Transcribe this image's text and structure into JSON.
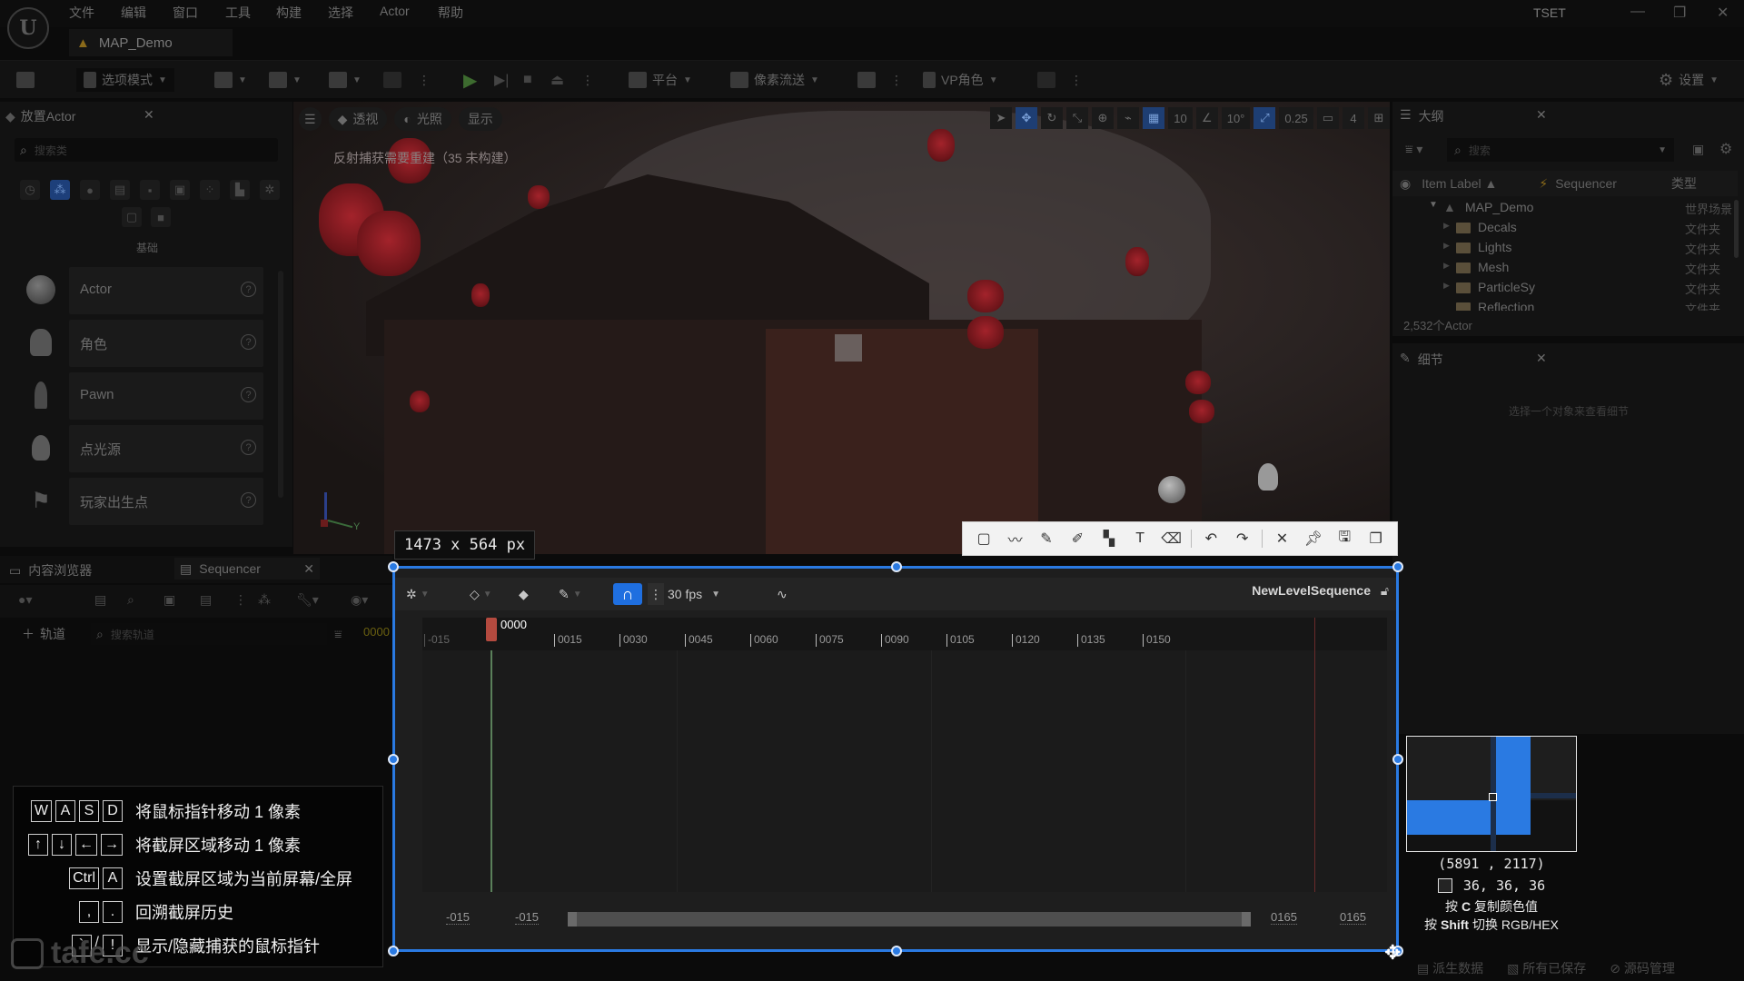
{
  "menubar": {
    "items": [
      "文件",
      "编辑",
      "窗口",
      "工具",
      "构建",
      "选择",
      "Actor",
      "帮助"
    ],
    "title": "TSET",
    "window_controls": [
      "minimize",
      "restore",
      "close"
    ]
  },
  "doc_tab": {
    "label": "MAP_Demo"
  },
  "toolbar": {
    "mode_label": "选项模式",
    "platform_label": "平台",
    "pixel_streaming_label": "像素流送",
    "vp_role_label": "VP角色",
    "settings_label": "设置"
  },
  "place_actors": {
    "title": "放置Actor",
    "search_placeholder": "搜索类",
    "section_label": "基础",
    "items": [
      {
        "label": "Actor",
        "icon": "sphere-icon"
      },
      {
        "label": "角色",
        "icon": "character-icon"
      },
      {
        "label": "Pawn",
        "icon": "pawn-icon"
      },
      {
        "label": "点光源",
        "icon": "point-light-icon"
      },
      {
        "label": "玩家出生点",
        "icon": "player-start-icon"
      }
    ]
  },
  "viewport": {
    "view_mode_buttons": [
      "透视",
      "光照",
      "显示"
    ],
    "warning": "反射捕获需要重建（35 未构建）",
    "grid_snap": "10",
    "rotation_snap": "10°",
    "scale_snap": "0.25",
    "camera_speed": "4"
  },
  "outliner": {
    "title": "大纲",
    "search_placeholder": "搜索",
    "columns": [
      "Item Label ▲",
      "Sequencer",
      "类型"
    ],
    "rows": [
      {
        "name": "MAP_Demo",
        "type": "世界场景"
      },
      {
        "name": "Decals",
        "type": "文件夹"
      },
      {
        "name": "Lights",
        "type": "文件夹"
      },
      {
        "name": "Mesh",
        "type": "文件夹"
      },
      {
        "name": "ParticleSy",
        "type": "文件夹"
      },
      {
        "name": "Reflection",
        "type": "文件夹"
      }
    ],
    "actor_count": "2,532个Actor"
  },
  "details": {
    "title": "细节",
    "hint": "选择一个对象来查看细节"
  },
  "bottom_tabs": {
    "content_browser": "内容浏览器",
    "sequencer": "Sequencer",
    "add_track": "轨道",
    "track_search_placeholder": "搜索轨道",
    "frame": "0000"
  },
  "sequencer": {
    "fps": "30 fps",
    "sequence_name": "NewLevelSequence",
    "playhead": "0000",
    "ticks": [
      "-015",
      "0015",
      "0030",
      "0045",
      "0060",
      "0075",
      "0090",
      "0105",
      "0120",
      "0135",
      "0150"
    ],
    "view_range_start": "-015",
    "working_range_start": "-015",
    "working_range_end": "0165",
    "view_range_end": "0165"
  },
  "capture": {
    "dimensions": "1473 x 564 px",
    "annotation_tools": [
      "rectangle-icon",
      "pen-icon",
      "pencil-icon",
      "marker-icon",
      "mosaic-icon",
      "text-icon",
      "eraser-icon",
      "undo-icon",
      "redo-icon",
      "cancel-icon",
      "pin-icon",
      "save-icon",
      "copy-icon"
    ],
    "coords": "(5891 , 2117)",
    "color_value": "36,  36,  36",
    "color_hex": "#242424",
    "hint_copy_pre": "按",
    "hint_copy_key": "C",
    "hint_copy_post": "复制颜色值",
    "hint_switch_pre": "按",
    "hint_switch_key": "Shift",
    "hint_switch_post": "切换 RGB/HEX",
    "accent": "#2a7ae2"
  },
  "shortcuts": [
    {
      "keys": [
        "W",
        "A",
        "S",
        "D"
      ],
      "sep": "",
      "text": "将鼠标指针移动 1 像素"
    },
    {
      "keys": [
        "↑",
        "↓",
        "←",
        "→"
      ],
      "sep": "",
      "text": "将截屏区域移动 1 像素"
    },
    {
      "keys": [
        "Ctrl",
        "A"
      ],
      "sep": "",
      "text": "设置截屏区域为当前屏幕/全屏"
    },
    {
      "keys": [
        ",",
        "."
      ],
      "sep": "",
      "text": "回溯截屏历史"
    },
    {
      "keys": [
        "`",
        "!"
      ],
      "sep": "/",
      "text": "显示/隐藏捕获的鼠标指针"
    }
  ],
  "statusbar": {
    "derived_data": "派生数据",
    "all_saved": "所有已保存",
    "source_control": "源码管理"
  },
  "watermark": "tafe.cc"
}
